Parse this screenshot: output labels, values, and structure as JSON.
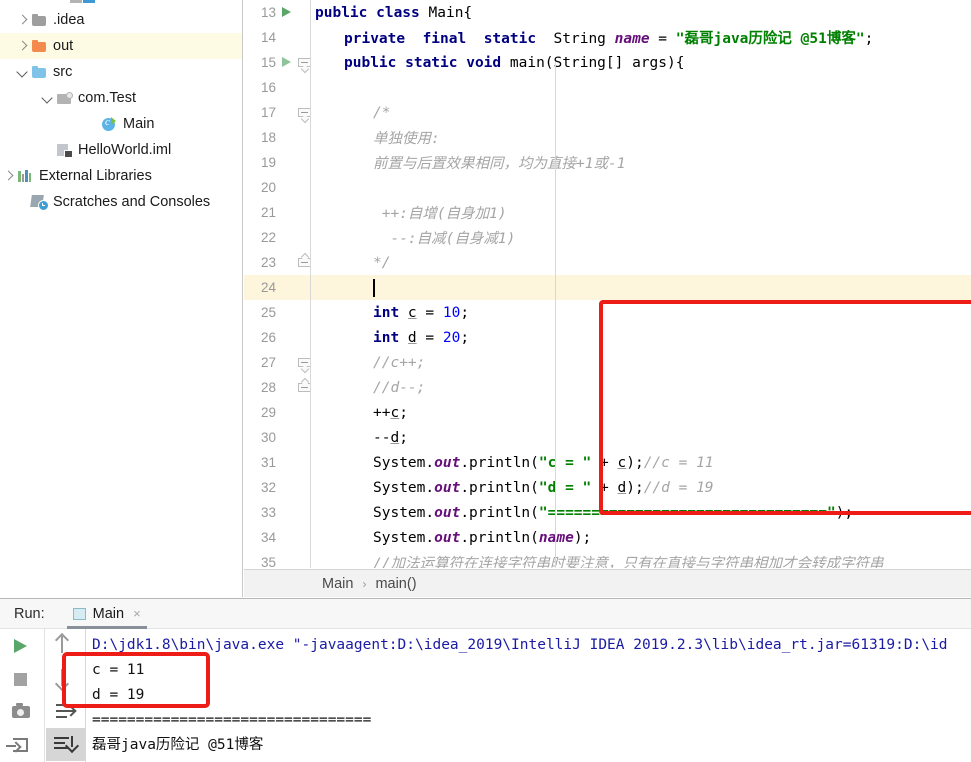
{
  "project_tree": {
    "items": [
      {
        "label": ".idea",
        "icon": "folder-grey-icon",
        "twisty": "right",
        "indent": 30,
        "selected": false
      },
      {
        "label": "out",
        "icon": "folder-orange-icon",
        "twisty": "right",
        "indent": 30,
        "selected": true
      },
      {
        "label": "src",
        "icon": "folder-blue-icon",
        "twisty": "down",
        "indent": 30,
        "selected": false
      },
      {
        "label": "com.Test",
        "icon": "package-icon",
        "twisty": "down",
        "indent": 55,
        "selected": false
      },
      {
        "label": "Main",
        "icon": "java-class-icon",
        "twisty": "none",
        "indent": 100,
        "selected": false
      },
      {
        "label": "HelloWorld.iml",
        "icon": "iml-file-icon",
        "twisty": "none",
        "indent": 55,
        "selected": false
      },
      {
        "label": "External Libraries",
        "icon": "libraries-icon",
        "twisty": "right",
        "indent": 5,
        "selected": false
      },
      {
        "label": "Scratches and Consoles",
        "icon": "scratches-icon",
        "twisty": "none",
        "indent": 30,
        "selected": false
      }
    ]
  },
  "editor": {
    "lines": [
      {
        "n": "13",
        "run": true,
        "fold": "none",
        "highlight": false,
        "tokens": [
          {
            "t": "public ",
            "c": "kw"
          },
          {
            "t": "class ",
            "c": "kw"
          },
          {
            "t": "Main{",
            "c": "pln"
          }
        ],
        "indent": 0
      },
      {
        "n": "14",
        "run": false,
        "fold": "none",
        "highlight": false,
        "tokens": [
          {
            "t": "private  ",
            "c": "kw"
          },
          {
            "t": "final  ",
            "c": "kw"
          },
          {
            "t": "static  ",
            "c": "kw"
          },
          {
            "t": "String ",
            "c": "pln"
          },
          {
            "t": "name",
            "c": "fld"
          },
          {
            "t": " = ",
            "c": "pln"
          },
          {
            "t": "\"磊哥java历险记 @51博客\"",
            "c": "str"
          },
          {
            "t": ";",
            "c": "pln"
          }
        ],
        "indent": 1
      },
      {
        "n": "15",
        "run": true,
        "fold": "down",
        "highlight": false,
        "tokens": [
          {
            "t": "public ",
            "c": "kw"
          },
          {
            "t": "static ",
            "c": "kw"
          },
          {
            "t": "void ",
            "c": "kw"
          },
          {
            "t": "main(String[] args){",
            "c": "pln"
          }
        ],
        "indent": 1
      },
      {
        "n": "16",
        "run": false,
        "fold": "none",
        "highlight": false,
        "tokens": [],
        "indent": 1
      },
      {
        "n": "17",
        "run": false,
        "fold": "down",
        "highlight": false,
        "tokens": [
          {
            "t": "/*",
            "c": "cmt"
          }
        ],
        "indent": 2
      },
      {
        "n": "18",
        "run": false,
        "fold": "none",
        "highlight": false,
        "tokens": [
          {
            "t": "单独使用:",
            "c": "cmt"
          }
        ],
        "indent": 2
      },
      {
        "n": "19",
        "run": false,
        "fold": "none",
        "highlight": false,
        "tokens": [
          {
            "t": "前置与后置效果相同，均为直接+1或-1",
            "c": "cmt"
          }
        ],
        "indent": 2
      },
      {
        "n": "20",
        "run": false,
        "fold": "none",
        "highlight": false,
        "tokens": [],
        "indent": 2
      },
      {
        "n": "21",
        "run": false,
        "fold": "none",
        "highlight": false,
        "tokens": [
          {
            "t": " ++:自增(自身加1)",
            "c": "cmt"
          }
        ],
        "indent": 2
      },
      {
        "n": "22",
        "run": false,
        "fold": "none",
        "highlight": false,
        "tokens": [
          {
            "t": "  --:自减(自身减1)",
            "c": "cmt"
          }
        ],
        "indent": 2
      },
      {
        "n": "23",
        "run": false,
        "fold": "up",
        "highlight": false,
        "tokens": [
          {
            "t": "*/",
            "c": "cmt"
          }
        ],
        "indent": 2
      },
      {
        "n": "24",
        "run": false,
        "fold": "none",
        "highlight": true,
        "tokens": [],
        "indent": 2,
        "caret": true
      },
      {
        "n": "25",
        "run": false,
        "fold": "none",
        "highlight": false,
        "tokens": [
          {
            "t": "int ",
            "c": "kw"
          },
          {
            "t": "c",
            "c": "var"
          },
          {
            "t": " = ",
            "c": "pln"
          },
          {
            "t": "10",
            "c": "num"
          },
          {
            "t": ";",
            "c": "pln"
          }
        ],
        "indent": 2
      },
      {
        "n": "26",
        "run": false,
        "fold": "none",
        "highlight": false,
        "tokens": [
          {
            "t": "int ",
            "c": "kw"
          },
          {
            "t": "d",
            "c": "var"
          },
          {
            "t": " = ",
            "c": "pln"
          },
          {
            "t": "20",
            "c": "num"
          },
          {
            "t": ";",
            "c": "pln"
          }
        ],
        "indent": 2
      },
      {
        "n": "27",
        "run": false,
        "fold": "down",
        "highlight": false,
        "tokens": [
          {
            "t": "//c++;",
            "c": "cmt"
          }
        ],
        "indent": 2
      },
      {
        "n": "28",
        "run": false,
        "fold": "up",
        "highlight": false,
        "tokens": [
          {
            "t": "//d--;",
            "c": "cmt"
          }
        ],
        "indent": 2
      },
      {
        "n": "29",
        "run": false,
        "fold": "none",
        "highlight": false,
        "tokens": [
          {
            "t": "++",
            "c": "pln"
          },
          {
            "t": "c",
            "c": "var"
          },
          {
            "t": ";",
            "c": "pln"
          }
        ],
        "indent": 2
      },
      {
        "n": "30",
        "run": false,
        "fold": "none",
        "highlight": false,
        "tokens": [
          {
            "t": "--",
            "c": "pln"
          },
          {
            "t": "d",
            "c": "var"
          },
          {
            "t": ";",
            "c": "pln"
          }
        ],
        "indent": 2
      },
      {
        "n": "31",
        "run": false,
        "fold": "none",
        "highlight": false,
        "tokens": [
          {
            "t": "System.",
            "c": "pln"
          },
          {
            "t": "out",
            "c": "fld"
          },
          {
            "t": ".println(",
            "c": "pln"
          },
          {
            "t": "\"c = \"",
            "c": "str"
          },
          {
            "t": " + ",
            "c": "pln"
          },
          {
            "t": "c",
            "c": "var"
          },
          {
            "t": ");",
            "c": "pln"
          },
          {
            "t": "//c = 11",
            "c": "cmt"
          }
        ],
        "indent": 2
      },
      {
        "n": "32",
        "run": false,
        "fold": "none",
        "highlight": false,
        "tokens": [
          {
            "t": "System.",
            "c": "pln"
          },
          {
            "t": "out",
            "c": "fld"
          },
          {
            "t": ".println(",
            "c": "pln"
          },
          {
            "t": "\"d = \"",
            "c": "str"
          },
          {
            "t": " + ",
            "c": "pln"
          },
          {
            "t": "d",
            "c": "var"
          },
          {
            "t": ");",
            "c": "pln"
          },
          {
            "t": "//d = 19",
            "c": "cmt"
          }
        ],
        "indent": 2
      },
      {
        "n": "33",
        "run": false,
        "fold": "none",
        "highlight": false,
        "tokens": [
          {
            "t": "System.",
            "c": "pln"
          },
          {
            "t": "out",
            "c": "fld"
          },
          {
            "t": ".println(",
            "c": "pln"
          },
          {
            "t": "\"================================\"",
            "c": "str"
          },
          {
            "t": ");",
            "c": "pln"
          }
        ],
        "indent": 2
      },
      {
        "n": "34",
        "run": false,
        "fold": "none",
        "highlight": false,
        "tokens": [
          {
            "t": "System.",
            "c": "pln"
          },
          {
            "t": "out",
            "c": "fld"
          },
          {
            "t": ".println(",
            "c": "pln"
          },
          {
            "t": "name",
            "c": "fld"
          },
          {
            "t": ");",
            "c": "pln"
          }
        ],
        "indent": 2
      },
      {
        "n": "35",
        "run": false,
        "fold": "none",
        "highlight": false,
        "tokens": [
          {
            "t": "//加法运算符在连接字符串时要注意，只有在直接与字符串相加才会转成字符串",
            "c": "cmt"
          }
        ],
        "indent": 2
      }
    ],
    "breadcrumb": {
      "class": "Main",
      "separator": "›",
      "method": "main()"
    },
    "annotation_box": {
      "color": "#ee1c17",
      "covers_lines": "25-32"
    },
    "current_line_highlight_color": "#fdf6dd"
  },
  "run_panel": {
    "run_label": "Run:",
    "tab_label": "Main",
    "tab_close": "×",
    "toolbar_left": [
      {
        "name": "rerun-button",
        "icon": "play-icon"
      },
      {
        "name": "stop-button",
        "icon": "stop-icon"
      },
      {
        "name": "dump-threads-button",
        "icon": "camera-icon"
      },
      {
        "name": "export-button",
        "icon": "export-icon"
      }
    ],
    "toolbar_right": [
      {
        "name": "prev-occurrence-button",
        "icon": "arrow-up-icon"
      },
      {
        "name": "next-occurrence-button",
        "icon": "arrow-down-icon"
      },
      {
        "name": "soft-wrap-button",
        "icon": "soft-wrap-icon"
      },
      {
        "name": "scroll-to-end-button",
        "icon": "scroll-to-end-icon"
      }
    ],
    "console": [
      {
        "text": "D:\\jdk1.8\\bin\\java.exe \"-javaagent:D:\\idea_2019\\IntelliJ IDEA 2019.2.3\\lib\\idea_rt.jar=61319:D:\\id",
        "kind": "cmd"
      },
      {
        "text": "c = 11",
        "kind": "out"
      },
      {
        "text": "d = 19",
        "kind": "out"
      },
      {
        "text": "================================",
        "kind": "out"
      },
      {
        "text": "磊哥java历险记 @51博客",
        "kind": "out"
      }
    ],
    "annotation_box": {
      "color": "#ee1c17",
      "covers_lines": "c = 11 / d = 19"
    }
  }
}
